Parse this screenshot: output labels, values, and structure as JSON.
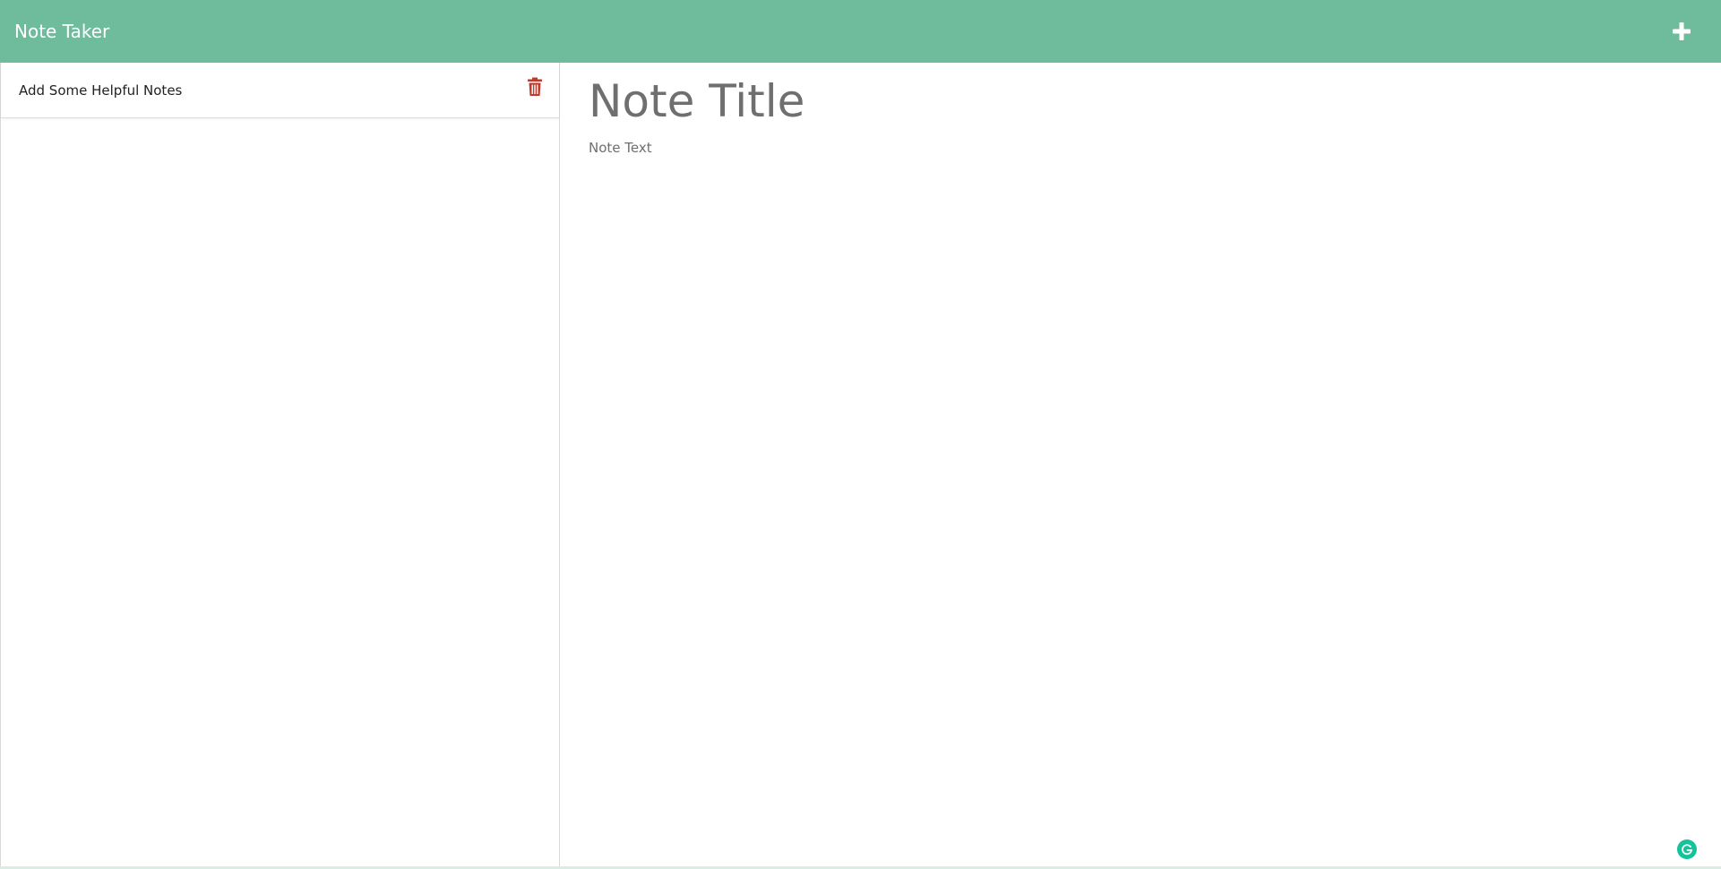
{
  "navbar": {
    "brand": "Note Taker",
    "add_icon": "plus-icon",
    "color": "#6fbc9d"
  },
  "sidebar": {
    "notes": [
      {
        "title": "Add Some Helpful Notes",
        "delete_icon": "trash-icon"
      }
    ]
  },
  "editor": {
    "title_placeholder": "Note Title",
    "text_placeholder": "Note Text"
  },
  "colors": {
    "accent": "#6fbc9d",
    "delete": "#c0392b",
    "placeholder": "#6f6f6f"
  },
  "extension": {
    "icon": "grammarly-icon"
  }
}
